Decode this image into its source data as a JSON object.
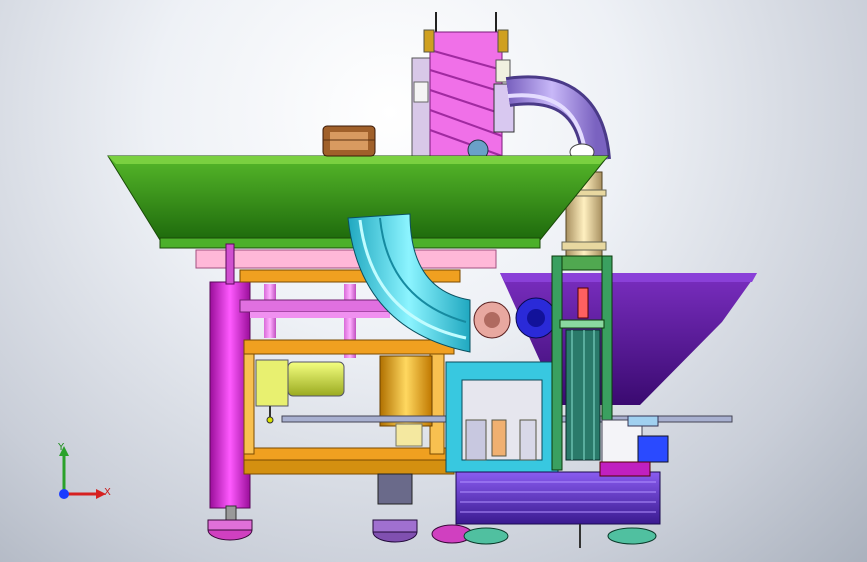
{
  "triad": {
    "y_label": "Y",
    "x_label": "X",
    "y_color": "#2aa12a",
    "x_color": "#d62020",
    "z_color": "#1a3cff"
  },
  "colors": {
    "hopper_green": "#2f8f16",
    "hopper_purple": "#5a1a9a",
    "frame_magenta": "#d01fd0",
    "frame_orange": "#f0a020",
    "chute_cyan": "#3ad0e0",
    "motor_yellow": "#d8e84a",
    "base_purple": "#6a2fd0",
    "pipe_lavender": "#9a80d8"
  }
}
